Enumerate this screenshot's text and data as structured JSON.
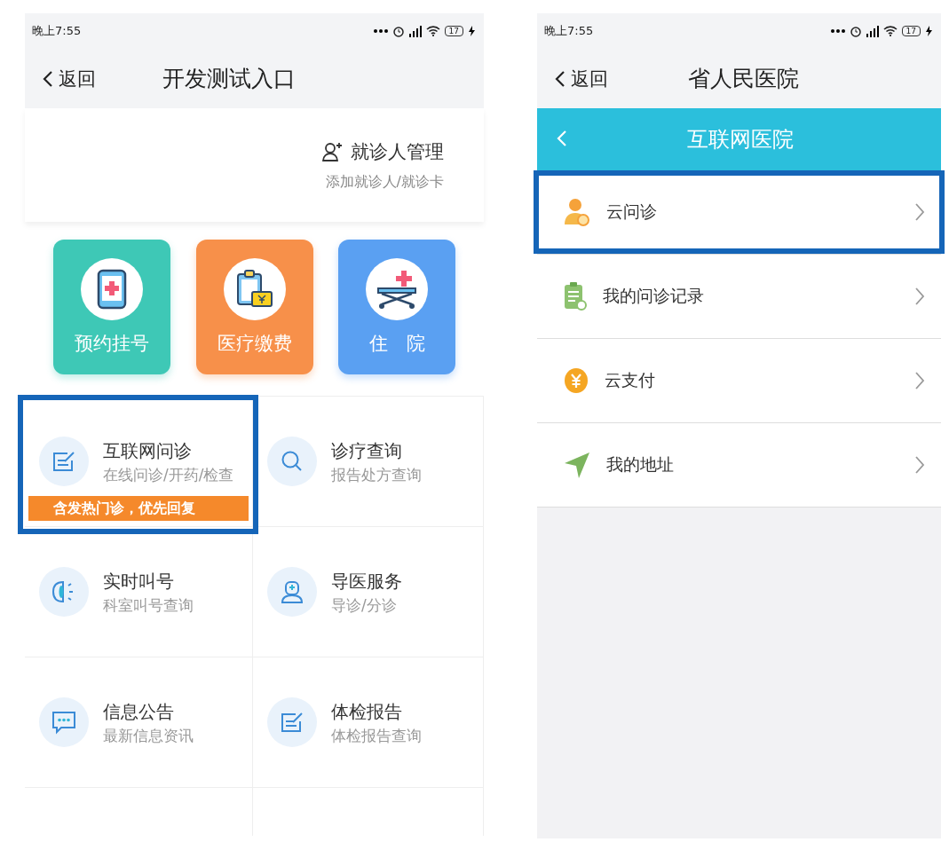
{
  "left_screen": {
    "status_bar": {
      "time": "晚上7:55",
      "battery": "17"
    },
    "nav": {
      "back": "返回",
      "title": "开发测试入口"
    },
    "patient_manage": {
      "title": "就诊人管理",
      "subtitle": "添加就诊人/就诊卡"
    },
    "tiles": [
      {
        "label": "预约挂号",
        "color": "#3ec8b6",
        "kind": "phone"
      },
      {
        "label": "医疗缴费",
        "color": "#f7904a",
        "kind": "bill"
      },
      {
        "label": "住　院",
        "color": "#5aa0f2",
        "kind": "bed"
      }
    ],
    "services": [
      {
        "title": "互联网问诊",
        "subtitle": "在线问诊/开药/检查",
        "badge": "含发热门诊，优先回复",
        "highlighted": true,
        "kind": "note"
      },
      {
        "title": "诊疗查询",
        "subtitle": "报告处方查询",
        "highlighted": false,
        "kind": "search"
      },
      {
        "title": "实时叫号",
        "subtitle": "科室叫号查询",
        "highlighted": false,
        "kind": "speaker"
      },
      {
        "title": "导医服务",
        "subtitle": "导诊/分诊",
        "highlighted": false,
        "kind": "doctor"
      },
      {
        "title": "信息公告",
        "subtitle": "最新信息资讯",
        "highlighted": false,
        "kind": "chat"
      },
      {
        "title": "体检报告",
        "subtitle": "体检报告查询",
        "highlighted": false,
        "kind": "note"
      }
    ]
  },
  "right_screen": {
    "status_bar": {
      "time": "晚上7:55",
      "battery": "17"
    },
    "nav": {
      "back": "返回",
      "title": "省人民医院"
    },
    "header": {
      "title": "互联网医院"
    },
    "items": [
      {
        "label": "云问诊",
        "highlighted": true,
        "kind": "doctor"
      },
      {
        "label": "我的问诊记录",
        "highlighted": false,
        "kind": "record"
      },
      {
        "label": "云支付",
        "highlighted": false,
        "kind": "yuan"
      },
      {
        "label": "我的地址",
        "highlighted": false,
        "kind": "location"
      }
    ]
  }
}
